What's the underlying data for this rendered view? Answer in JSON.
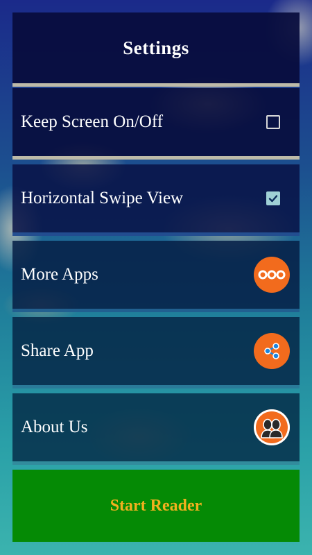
{
  "header": {
    "title": "Settings"
  },
  "settings": {
    "items": [
      {
        "label": "Keep Screen On/Off",
        "control": "checkbox",
        "checked": false,
        "icon": "checkbox-unchecked-icon"
      },
      {
        "label": "Horizontal Swipe View",
        "control": "checkbox",
        "checked": true,
        "icon": "checkbox-checked-icon"
      },
      {
        "label": "More Apps",
        "control": "button",
        "icon": "more-dots-icon"
      },
      {
        "label": "Share App",
        "control": "button",
        "icon": "share-icon"
      },
      {
        "label": "About Us",
        "control": "button",
        "icon": "people-icon"
      }
    ]
  },
  "footer": {
    "start_label": "Start Reader"
  },
  "colors": {
    "header_bg": "#080c3c",
    "accent_orange": "#f26b1d",
    "start_button_bg": "#058a05",
    "start_button_text": "#f2b01e",
    "checkbox_checked": "#9fd0d6"
  }
}
